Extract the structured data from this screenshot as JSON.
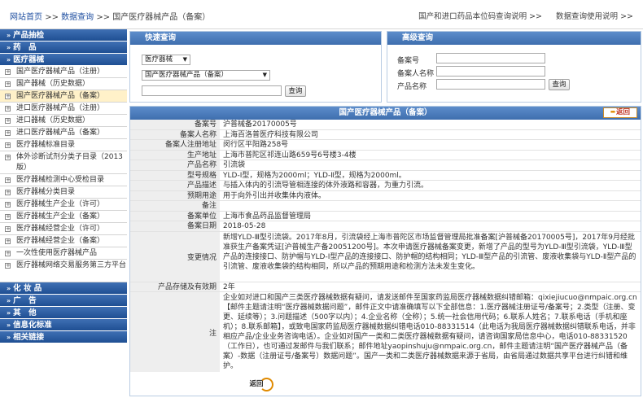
{
  "breadcrumb": {
    "home": "网站首页",
    "sep1": ">>",
    "query": "数据查询",
    "sep2": ">>",
    "current": "国产医疗器械产品（备案）"
  },
  "top_links": [
    "国产和进口药品本位码查询说明 >>",
    "数据查询使用说明 >>"
  ],
  "sidebar": {
    "categories": [
      {
        "label": "产品抽检"
      },
      {
        "label": "药　品"
      },
      {
        "label": "医疗器械"
      }
    ],
    "items": [
      {
        "label": "国产医疗器械产品（注册）"
      },
      {
        "label": "国产器械（历史数据）"
      },
      {
        "label": "国产医疗器械产品（备案）",
        "active": true
      },
      {
        "label": "进口医疗器械产品（注册）"
      },
      {
        "label": "进口器械（历史数据）"
      },
      {
        "label": "进口医疗器械产品（备案）"
      },
      {
        "label": "医疗器械标准目录"
      },
      {
        "label": "体外诊断试剂分类子目录（2013版）",
        "tall": true
      },
      {
        "label": "医疗器械检测中心受检目录"
      },
      {
        "label": "医疗器械分类目录"
      },
      {
        "label": "医疗器械生产企业（许可）"
      },
      {
        "label": "医疗器械生产企业（备案）"
      },
      {
        "label": "医疗器械经营企业（许可）"
      },
      {
        "label": "医疗器械经营企业（备案）"
      },
      {
        "label": "一次性使用医疗器械产品"
      },
      {
        "label": "医疗器械网络交易服务第三方平台",
        "tall": true
      }
    ],
    "bottom_categories": [
      {
        "label": "化 妆 品"
      },
      {
        "label": "广　告"
      },
      {
        "label": "其　他"
      },
      {
        "label": "信息化标准"
      },
      {
        "label": "相关链接"
      }
    ]
  },
  "quick_query": {
    "title": "快速查询",
    "select1": "医疗器械",
    "select2": "国产医疗器械产品（备案）",
    "search_value": "",
    "button": "查询"
  },
  "advanced_query": {
    "title": "高级查询",
    "fields": [
      {
        "label": "备案号",
        "value": ""
      },
      {
        "label": "备案人名称",
        "value": ""
      },
      {
        "label": "产品名称",
        "value": ""
      }
    ],
    "button": "查询"
  },
  "detail": {
    "title": "国产医疗器械产品（备案）",
    "back_label": "返回",
    "rows": [
      {
        "label": "备案号",
        "value": "沪普械备20170005号"
      },
      {
        "label": "备案人名称",
        "value": "上海百洛普医疗科技有限公司"
      },
      {
        "label": "备案人注册地址",
        "value": "闵行区平阳路258号"
      },
      {
        "label": "生产地址",
        "value": "上海市普陀区祁连山路659号6号楼3-4楼"
      },
      {
        "label": "产品名称",
        "value": "引流袋"
      },
      {
        "label": "型号规格",
        "value": "YLD-Ⅰ型，规格为2000ml；YLD-Ⅱ型，规格为2000ml。"
      },
      {
        "label": "产品描述",
        "value": "与插入体内的引流导管相连接的体外液路和容器，为重力引流。"
      },
      {
        "label": "预期用途",
        "value": "用于向外引出并收集体内液体。"
      },
      {
        "label": "备注",
        "value": ""
      },
      {
        "label": "备案单位",
        "value": "上海市食品药品监督管理局"
      },
      {
        "label": "备案日期",
        "value": "2018-05-28"
      }
    ],
    "change_label": "变更情况",
    "change_value": "新增YLD-Ⅲ型引流袋。2017年8月，引流袋经上海市普陀区市场监督管理局批准备案[沪普械备20170005号]，2017年9月经批准获生产备案凭证[沪普械生产备20051200号]。本次申请医疗器械备案变更，新增了产品的型号为YLD-Ⅲ型引流袋，YLD-Ⅲ型产品的连接接口、防护帽与YLD-Ⅰ型产品的连接接口、防护帽的结构相同；YLD-Ⅲ型产品的引流管、废液收集袋与YLD-Ⅱ型产品的引流管、废液收集袋的结构相同，所以产品的预期用途和检测方法未发生变化。",
    "storage_label": "产品存储及有效期",
    "storage_value": "2年",
    "note_label": "注",
    "note_value": "企业如对进口和国产三类医疗器械数据有疑问，请发送邮件至国家药监局医疗器械数据纠错邮箱：qixiejiucuo@nmpaic.org.cn【邮件主题请注明“医疗器械数据问题”，邮件正文中请准确填写以下全部信息：1.医疗器械注册证号/备案号；2.类型（注册、变更、延续等）；3.问题描述（500字以内）；4.企业名称（全称）；5.统一社会信用代码；6.联系人姓名；7.联系电话（手机和座机）；8.联系邮箱】，或致电国家药监局医疗器械数据纠错电话010-88331514（此电话为我局医疗器械数据纠错联系电话，并非相应产品/企业业务咨询电话）。企业如对国产一类和二类医疗器械数据有疑问，请咨询国家局信息中心，电话010-88331520（工作日），也可通过发邮件与我们联系；邮件地址yaopinshuju@nmpaic.org.cn，邮件主题请注明“国产医疗器械产品（备案）-数据（注册证号/备案号）数据问题”。国产一类和二类医疗器械数据来源于省局，由省局通过数据共享平台进行纠错和维护。",
    "footer_back": "返回"
  },
  "colors": {
    "sidebar_header": "#2c5ba0",
    "panel_header": "#4a7bbd",
    "active_item": "#fff1c9",
    "link": "#1f4fa0"
  }
}
